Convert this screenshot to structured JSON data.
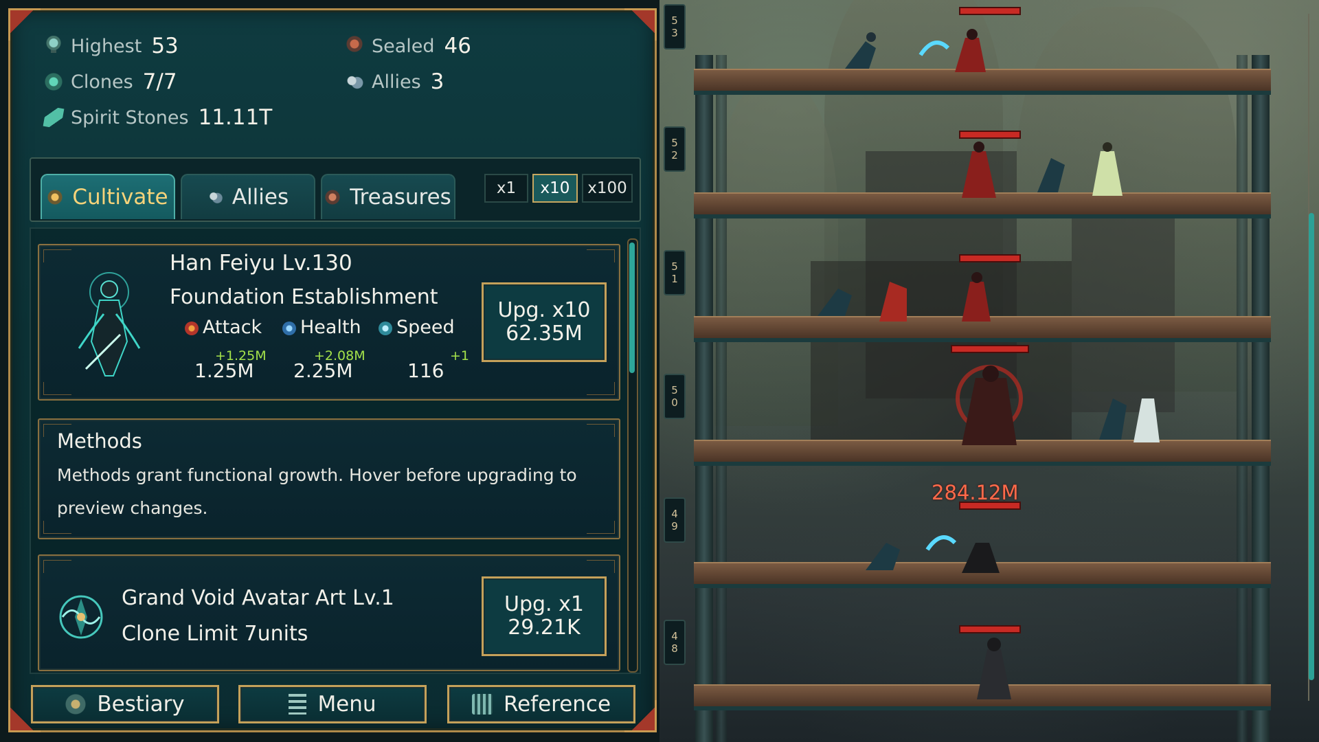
{
  "stats": {
    "highest_label": "Highest",
    "highest_value": "53",
    "sealed_label": "Sealed",
    "sealed_value": "46",
    "clones_label": "Clones",
    "clones_value": "7/7",
    "allies_label": "Allies",
    "allies_value": "3",
    "stones_label": "Spirit Stones",
    "stones_value": "11.11T"
  },
  "tabs": [
    {
      "label": "Cultivate",
      "active": true
    },
    {
      "label": "Allies",
      "active": false
    },
    {
      "label": "Treasures",
      "active": false
    }
  ],
  "multipliers": [
    {
      "label": "x1",
      "active": false
    },
    {
      "label": "x10",
      "active": true
    },
    {
      "label": "x100",
      "active": false
    }
  ],
  "hero": {
    "name": "Han Feiyu Lv.130",
    "realm": "Foundation Establishment",
    "attack_label": "Attack",
    "attack_value": "1.25M",
    "attack_plus": "+1.25M",
    "health_label": "Health",
    "health_value": "2.25M",
    "health_plus": "+2.08M",
    "speed_label": "Speed",
    "speed_value": "116",
    "speed_plus": "+1",
    "upg_line1": "Upg. x10",
    "upg_line2": "62.35M"
  },
  "methods": {
    "title": "Methods",
    "desc_line1": "Methods grant functional growth. Hover before upgrading to",
    "desc_line2": "preview changes."
  },
  "art": {
    "name": "Grand Void Avatar Art Lv.1",
    "effect": "Clone Limit 7units",
    "upg_line1": "Upg. x1",
    "upg_line2": "29.21K"
  },
  "bottom_buttons": {
    "bestiary": "Bestiary",
    "menu": "Menu",
    "reference": "Reference"
  },
  "floors": [
    {
      "d1": "5",
      "d2": "3"
    },
    {
      "d1": "5",
      "d2": "2"
    },
    {
      "d1": "5",
      "d2": "1"
    },
    {
      "d1": "5",
      "d2": "0"
    },
    {
      "d1": "4",
      "d2": "9"
    },
    {
      "d1": "4",
      "d2": "8"
    }
  ],
  "damage_text": "284.12M",
  "colors": {
    "accent_gold": "#c5a15a",
    "tab_active_text": "#f6d37a",
    "panel_teal": "#0f3b40",
    "hp_red": "#c82a24",
    "bonus_green": "#a4e24a"
  }
}
